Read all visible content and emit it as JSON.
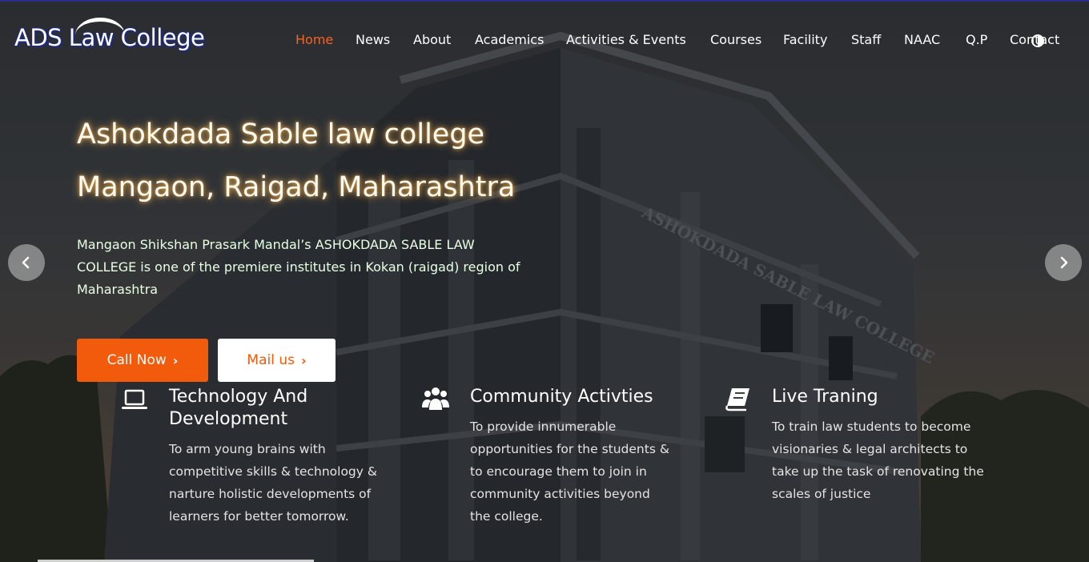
{
  "brand": {
    "logo_text": "ADS Law College"
  },
  "nav": {
    "items": [
      "Home",
      "News",
      "About",
      "Academics",
      "Activities & Events",
      "Courses",
      "Facility",
      "Staff",
      "NAAC",
      "Q.P",
      "Contact"
    ],
    "active": "Home"
  },
  "hero": {
    "title_line1": "Ashokdada Sable law college",
    "title_line2": "Mangaon, Raigad, Maharashtra",
    "intro": "Mangaon Shikshan Prasark Mandal’s ASHOKDADA SABLE LAW COLLEGE is one of the premiere institutes in Kokan (raigad) region of Maharashtra",
    "call_button": "Call Now",
    "mail_button": "Mail us",
    "building_sign": "ASHOKDADA SABLE LAW COLLEGE"
  },
  "features": [
    {
      "icon": "laptop-icon",
      "title": "Technology And Development",
      "description": "To arm young brains with competitive skills & technology & narture holistic developments of learners for better tomorrow."
    },
    {
      "icon": "users-icon",
      "title": "Community Activties",
      "description": "To provide innumerable opportunities for the students & to encourage them to join in community activities beyond the college."
    },
    {
      "icon": "book-icon",
      "title": "Live Traning",
      "description": "To train law students to become visionaries & legal architects to take up the task of renovating the scales of justice"
    }
  ],
  "colors": {
    "accent": "#f25a0c",
    "nav_active": "#f2642a",
    "logo_outline": "#1f2a7a"
  }
}
